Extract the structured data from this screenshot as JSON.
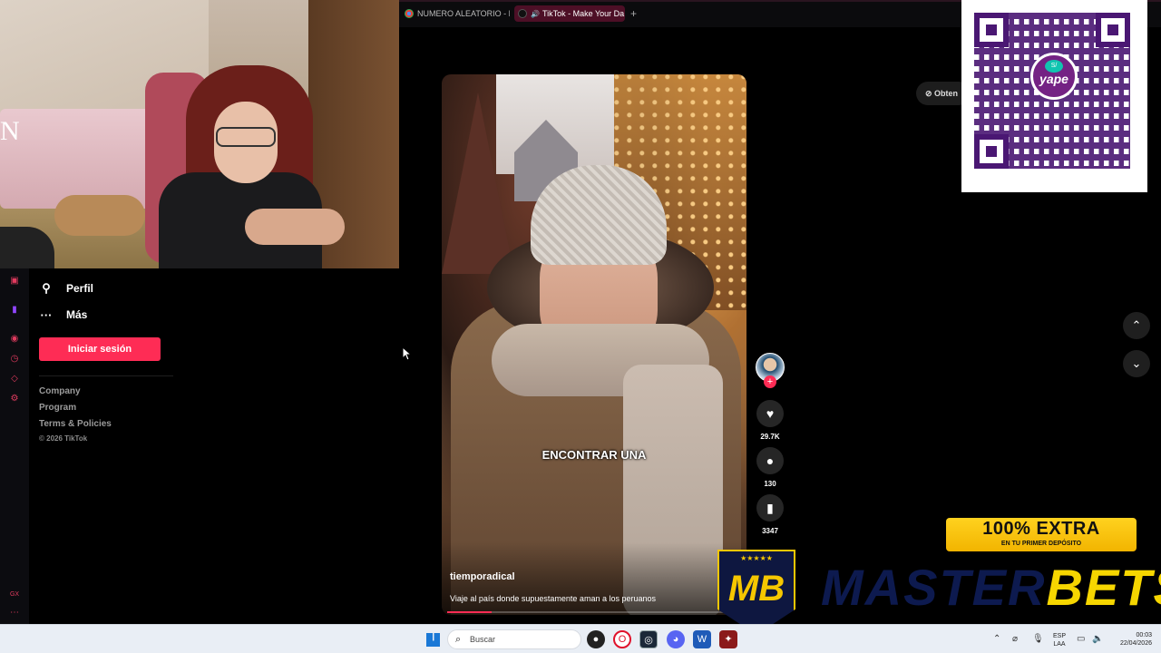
{
  "browser": {
    "tabs": [
      {
        "label": "NUMERO ALEATORIO - Bu",
        "active": false
      },
      {
        "label": "TikTok - Make Your Da",
        "active": true
      }
    ],
    "new_tab": "+"
  },
  "webcam": {
    "overlay_letter": "N"
  },
  "sidebar": {
    "items": [
      {
        "label": "Perfil",
        "icon": "person-icon"
      },
      {
        "label": "Más",
        "icon": "more-dots-icon"
      }
    ],
    "login_label": "Iniciar sesión",
    "footer_links": [
      "Company",
      "Program",
      "Terms & Policies"
    ],
    "copyright": "© 2026 TikTok"
  },
  "video": {
    "caption": "ENCONTRAR UNA",
    "author": "tiemporadical",
    "description": "Viaje al país donde supuestamente aman a los peruanos",
    "progress": 0.15
  },
  "actions": {
    "likes": "29.7K",
    "comments": "130",
    "saves": "3347"
  },
  "get_app_label": "Obten",
  "qr": {
    "logo_text": "yape",
    "badge": "S/"
  },
  "promo": {
    "headline": "100% EXTRA",
    "sub": "EN TU PRIMER DEPÓSITO"
  },
  "masterbets": {
    "shield_text": "MB",
    "stars": "★★★★★",
    "word1": "MASTER",
    "word2": "BETS"
  },
  "taskbar": {
    "search_placeholder": "Buscar",
    "lang_top": "ESP",
    "lang_bottom": "LAA",
    "time": "00:03",
    "date": "22/04/2026"
  },
  "colors": {
    "accent": "#fe2c55",
    "yape": "#742284",
    "mb_yellow": "#f6d600",
    "mb_navy": "#0d1a4f"
  }
}
